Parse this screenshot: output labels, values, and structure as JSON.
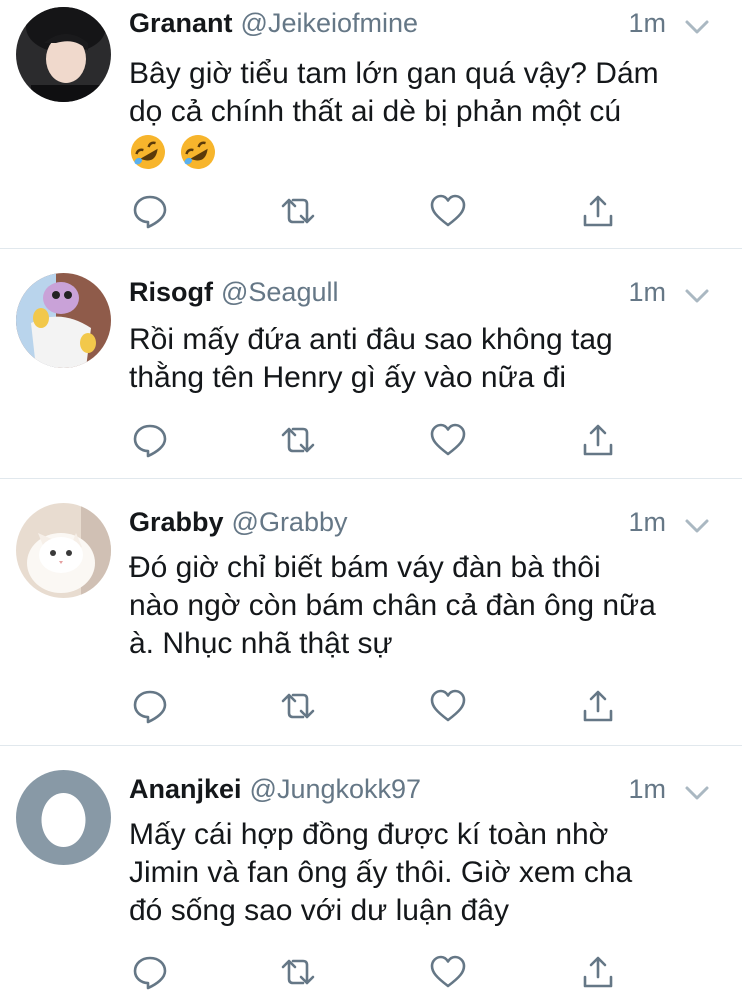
{
  "tweets": [
    {
      "name": "Granant",
      "handle": "@Jeikeiofmine",
      "time": "1m",
      "text": "Bây giờ tiểu tam lớn gan quá vậy? Dám\ndọ cả chính thất ai dè bị phản một cú",
      "emojis": [
        "rolling-on-floor-laughing",
        "rolling-on-floor-laughing"
      ],
      "avatar": "photo-person"
    },
    {
      "name": "Risogf",
      "handle": "@Seagull",
      "time": "1m",
      "text": "Rồi mấy đứa anti đâu sao không tag\nthằng tên Henry gì ấy vào nữa đi",
      "avatar": "cartoon-character"
    },
    {
      "name": "Grabby",
      "handle": "@Grabby",
      "time": "1m",
      "text": "Đó giờ chỉ biết bám váy đàn bà thôi\nnào ngờ còn bám chân cả đàn ông nữa\nà. Nhục nhã thật sự",
      "avatar": "white-cat-photo"
    },
    {
      "name": "Ananjkei",
      "handle": "@Jungkokk97",
      "time": "1m",
      "text": "Mấy cái hợp đồng được kí toàn nhờ\nJimin và fan ông ấy thôi. Giờ xem cha\nđó sống sao với dư luận đây",
      "avatar": "default-egg-avatar"
    }
  ],
  "icons": {
    "reply": "reply-icon",
    "retweet": "retweet-icon",
    "like": "like-icon",
    "share": "share-icon",
    "caret": "chevron-down-icon"
  },
  "colors": {
    "icon_gray": "#657786",
    "divider": "#e1e8ed",
    "egg_bg": "#8899a6"
  }
}
